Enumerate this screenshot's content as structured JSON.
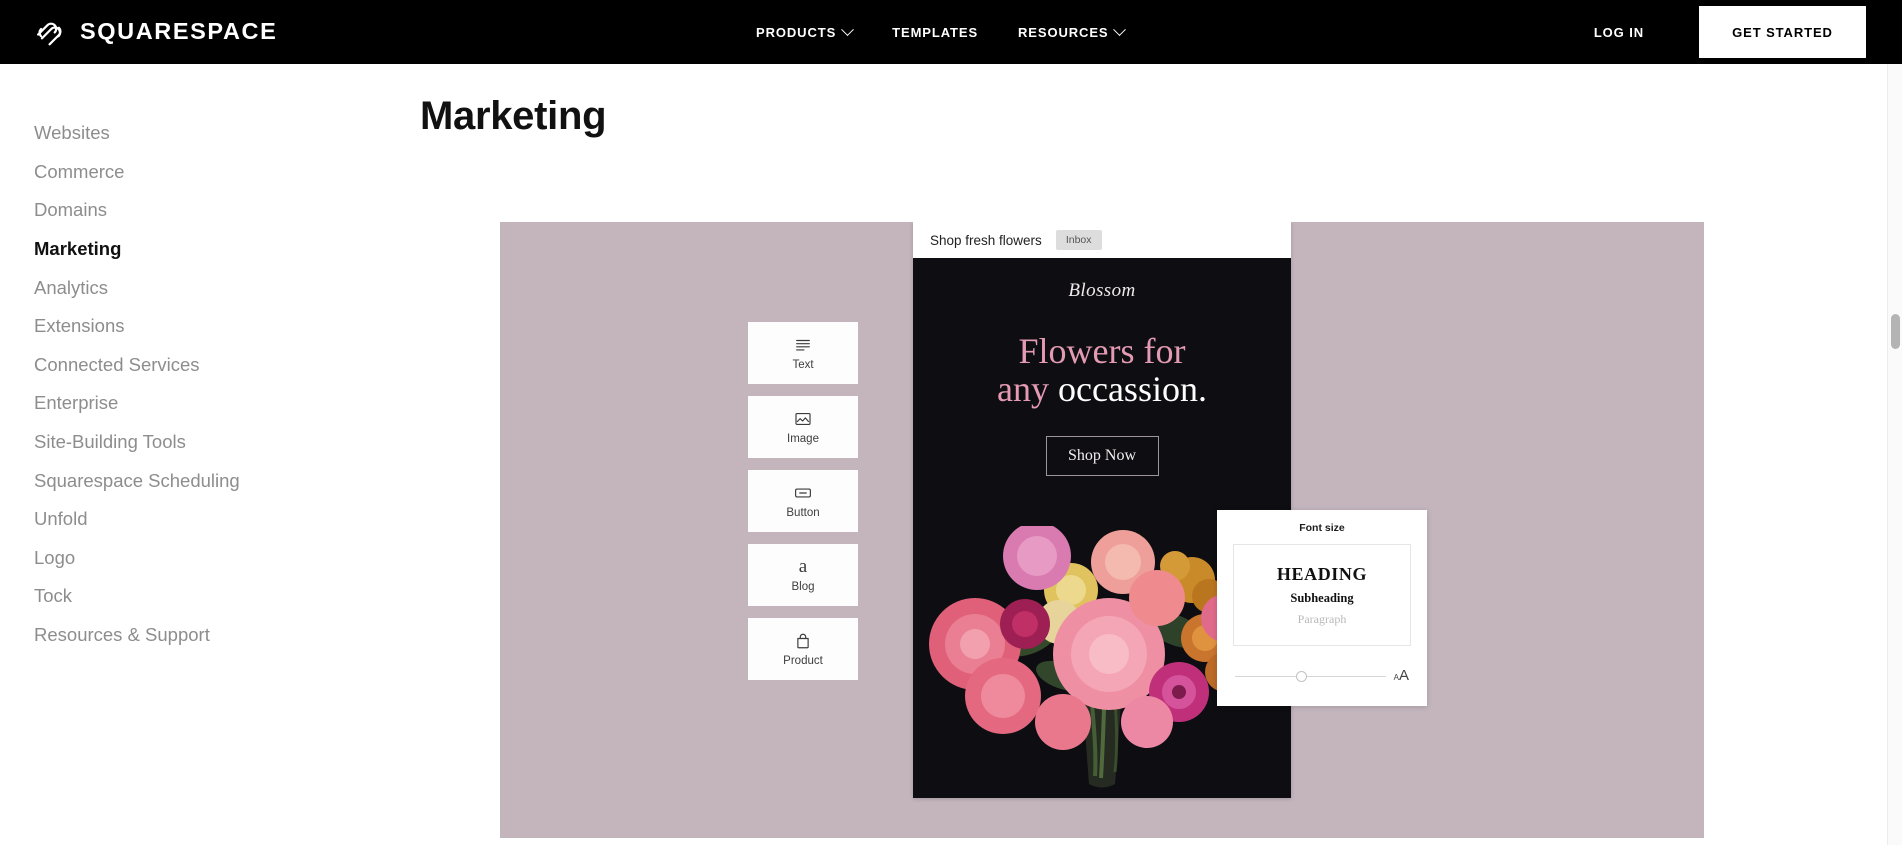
{
  "topnav": {
    "logo_text": "SQUARESPACE",
    "logo_icon": "squarespace-logo-icon",
    "links": [
      {
        "label": "PRODUCTS",
        "has_caret": true
      },
      {
        "label": "TEMPLATES",
        "has_caret": false
      },
      {
        "label": "RESOURCES",
        "has_caret": true
      }
    ],
    "login_label": "LOG IN",
    "get_started_label": "GET STARTED"
  },
  "sidebar": {
    "items": [
      {
        "label": "Websites",
        "active": false
      },
      {
        "label": "Commerce",
        "active": false
      },
      {
        "label": "Domains",
        "active": false
      },
      {
        "label": "Marketing",
        "active": true
      },
      {
        "label": "Analytics",
        "active": false
      },
      {
        "label": "Extensions",
        "active": false
      },
      {
        "label": "Connected Services",
        "active": false
      },
      {
        "label": "Enterprise",
        "active": false
      },
      {
        "label": "Site-Building Tools",
        "active": false
      },
      {
        "label": "Squarespace Scheduling",
        "active": false
      },
      {
        "label": "Unfold",
        "active": false
      },
      {
        "label": "Logo",
        "active": false
      },
      {
        "label": "Tock",
        "active": false
      },
      {
        "label": "Resources & Support",
        "active": false
      }
    ]
  },
  "main": {
    "page_title": "Marketing"
  },
  "hero": {
    "background_color": "#c4b5bd",
    "palette": [
      {
        "label": "Text",
        "icon": "text-lines-icon"
      },
      {
        "label": "Image",
        "icon": "image-picture-icon"
      },
      {
        "label": "Button",
        "icon": "button-rect-icon"
      },
      {
        "label": "Blog",
        "icon": "blog-letter-a-icon"
      },
      {
        "label": "Product",
        "icon": "shopping-bag-icon"
      }
    ],
    "email": {
      "subject": "Shop fresh flowers",
      "inbox_chip": "Inbox",
      "brand": "Blossom",
      "headline_line1_pink": "Flowers for",
      "headline_line2_pink": "any ",
      "headline_line2_white": "occassion.",
      "cta_label": "Shop Now",
      "accent_pink": "#e49ab2",
      "body_background": "#0e0e12",
      "image_alt": "flower-bouquet-image"
    },
    "font_panel": {
      "title": "Font size",
      "heading_sample": "HEADING",
      "subheading_sample": "Subheading",
      "paragraph_sample": "Paragraph",
      "slider_small_label": "A",
      "slider_large_label": "A",
      "slider_position_percent": 44
    }
  },
  "scrollbar": {
    "thumb_label": "vertical-scroll-thumb"
  }
}
